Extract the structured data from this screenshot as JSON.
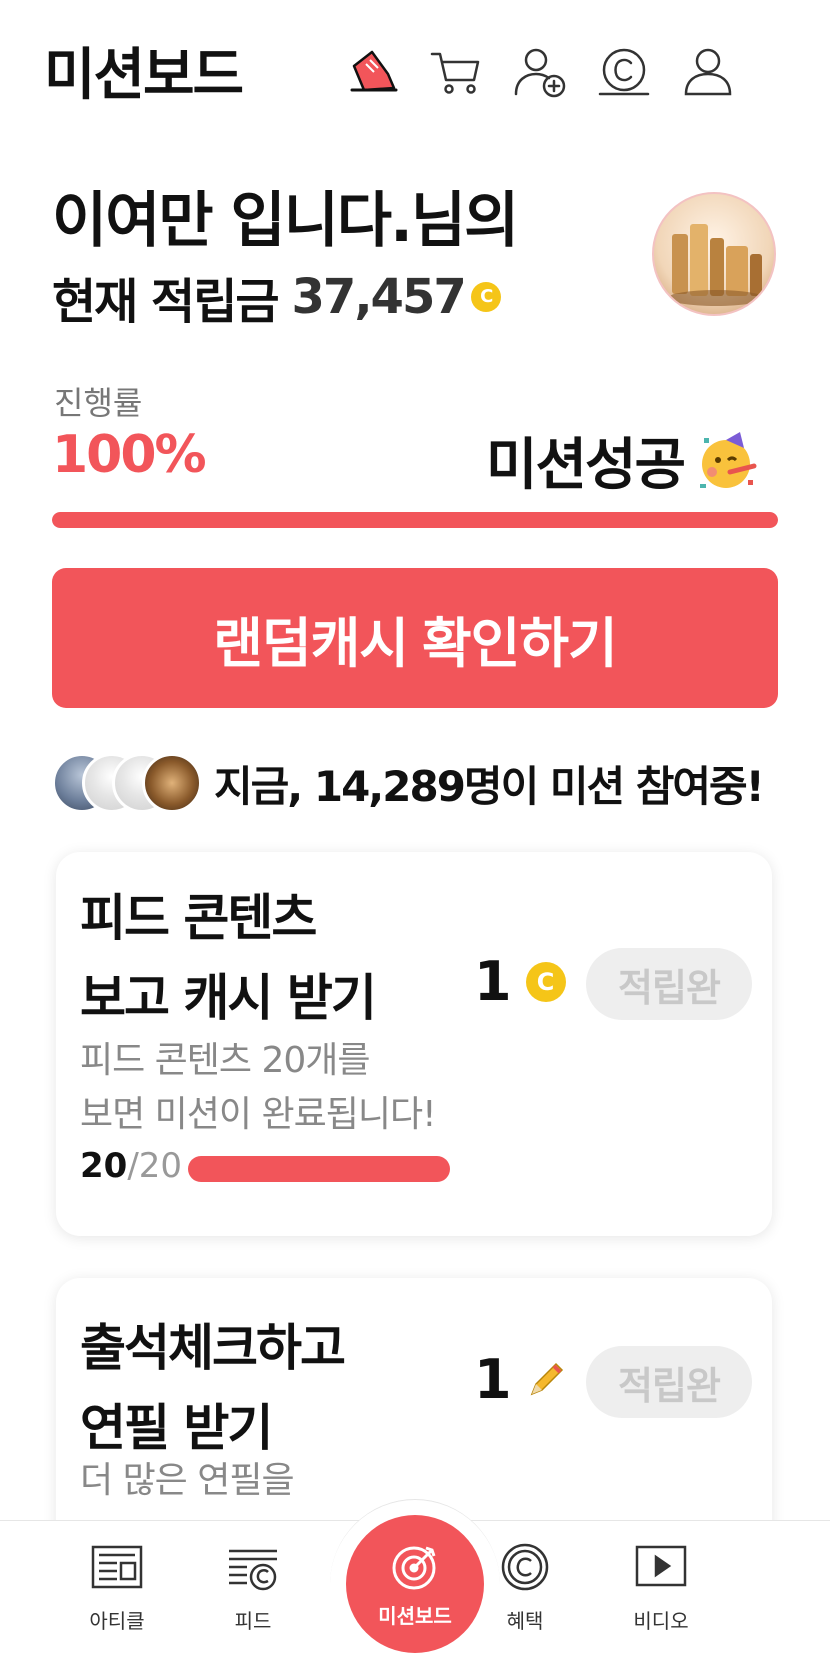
{
  "header": {
    "title": "미션보드",
    "icons": [
      "shoe-icon",
      "cart-icon",
      "add-user-icon",
      "coin-icon",
      "profile-icon"
    ]
  },
  "greeting": {
    "line1": "이여만 입니다.님의",
    "balance_label": "현재 적립금",
    "balance_value": "37,457",
    "coin_symbol": "C"
  },
  "progress": {
    "label": "진행률",
    "percent_text": "100%",
    "percent_value": 100,
    "status": "미션성공"
  },
  "cta": {
    "label": "랜덤캐시 확인하기"
  },
  "participants": {
    "text_prefix": "지금, ",
    "count": "14,289명",
    "text_suffix": "이 미션 참여중!"
  },
  "missions": [
    {
      "title_line1": "피드 콘텐츠",
      "title_line2": "보고 캐시 받기",
      "desc_line1": "피드 콘텐츠 20개를",
      "desc_line2": "보면 미션이 완료됩니다!",
      "progress_done": "20",
      "progress_total": "/20",
      "progress_fraction": 1,
      "reward_amount": "1",
      "reward_icon": "coin-icon",
      "button_label": "적립완"
    },
    {
      "title_line1": "출석체크하고",
      "title_line2": "연필 받기",
      "desc_line1": "더 많은 연필을",
      "reward_amount": "1",
      "reward_icon": "pencil-icon",
      "button_label": "적립완"
    }
  ],
  "bottom_nav": {
    "items": [
      "아티클",
      "피드",
      "미션보드",
      "혜택",
      "비디오"
    ]
  },
  "colors": {
    "accent": "#f2555a",
    "coin": "#f5c518",
    "muted": "#888888"
  }
}
